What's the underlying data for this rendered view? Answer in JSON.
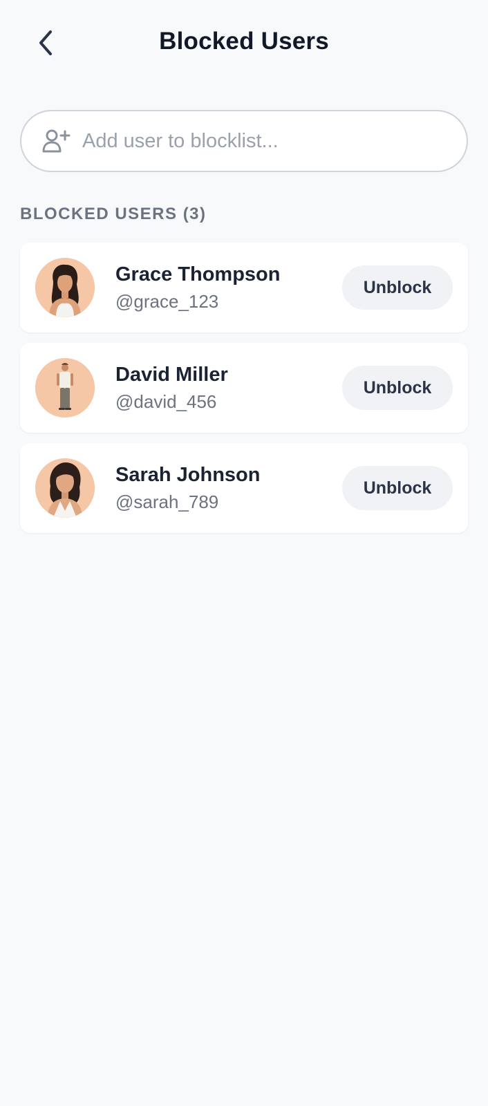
{
  "header": {
    "title": "Blocked Users",
    "back_icon": "chevron-left-icon"
  },
  "search": {
    "placeholder": "Add user to blocklist...",
    "value": "",
    "icon": "add-user-icon"
  },
  "section": {
    "label": "BLOCKED USERS (3)"
  },
  "users": [
    {
      "name": "Grace Thompson",
      "handle": "@grace_123",
      "action": "Unblock"
    },
    {
      "name": "David Miller",
      "handle": "@david_456",
      "action": "Unblock"
    },
    {
      "name": "Sarah Johnson",
      "handle": "@sarah_789",
      "action": "Unblock"
    }
  ],
  "colors": {
    "background": "#f8f9fb",
    "card": "#ffffff",
    "avatar_bg": "#f5c7a6",
    "button_bg": "#f1f2f5",
    "text_primary": "#111827",
    "text_secondary": "#6b7280"
  }
}
